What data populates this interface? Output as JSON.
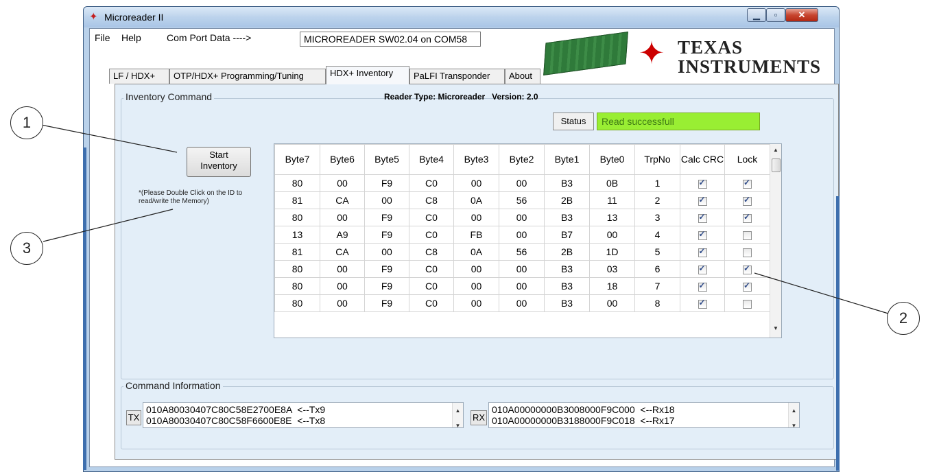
{
  "window": {
    "title": "Microreader II",
    "title_logo_icon": "ti-icon",
    "controls": {
      "minimize": "minimize-icon",
      "maximize": "maximize-icon",
      "close": "close-icon"
    }
  },
  "menu": {
    "file": "File",
    "help": "Help",
    "com_port_label": "Com Port Data ---->",
    "com_port_value": "MICROREADER SW02.04 on COM58"
  },
  "brand": {
    "line1": "Texas",
    "line2": "Instruments"
  },
  "tabs": [
    {
      "label": "LF / HDX+"
    },
    {
      "label": "OTP/HDX+ Programming/Tuning"
    },
    {
      "label": "HDX+ Inventory"
    },
    {
      "label": "PaLFI Transponder"
    },
    {
      "label": "About"
    }
  ],
  "inventory": {
    "group_title": "Inventory Command",
    "reader_type": "Reader Type: Microreader   Version: 2.0",
    "status_label": "Status",
    "status_value": "Read successfull",
    "start_button_line1": "Start",
    "start_button_line2": "Inventory",
    "note": "*(Please Double Click on the ID to read/write the Memory)"
  },
  "grid": {
    "headers": [
      "Byte7",
      "Byte6",
      "Byte5",
      "Byte4",
      "Byte3",
      "Byte2",
      "Byte1",
      "Byte0",
      "TrpNo",
      "Calc CRC",
      "Lock"
    ],
    "rows": [
      {
        "cells": [
          "80",
          "00",
          "F9",
          "C0",
          "00",
          "00",
          "B3",
          "0B",
          "1"
        ],
        "calc_crc": true,
        "lock": true
      },
      {
        "cells": [
          "81",
          "CA",
          "00",
          "C8",
          "0A",
          "56",
          "2B",
          "11",
          "2"
        ],
        "calc_crc": true,
        "lock": true
      },
      {
        "cells": [
          "80",
          "00",
          "F9",
          "C0",
          "00",
          "00",
          "B3",
          "13",
          "3"
        ],
        "calc_crc": true,
        "lock": true
      },
      {
        "cells": [
          "13",
          "A9",
          "F9",
          "C0",
          "FB",
          "00",
          "B7",
          "00",
          "4"
        ],
        "calc_crc": true,
        "lock": false
      },
      {
        "cells": [
          "81",
          "CA",
          "00",
          "C8",
          "0A",
          "56",
          "2B",
          "1D",
          "5"
        ],
        "calc_crc": true,
        "lock": false
      },
      {
        "cells": [
          "80",
          "00",
          "F9",
          "C0",
          "00",
          "00",
          "B3",
          "03",
          "6"
        ],
        "calc_crc": true,
        "lock": true
      },
      {
        "cells": [
          "80",
          "00",
          "F9",
          "C0",
          "00",
          "00",
          "B3",
          "18",
          "7"
        ],
        "calc_crc": true,
        "lock": true
      },
      {
        "cells": [
          "80",
          "00",
          "F9",
          "C0",
          "00",
          "00",
          "B3",
          "00",
          "8"
        ],
        "calc_crc": true,
        "lock": false
      }
    ],
    "scroll_up_icon": "scroll-up-icon",
    "scroll_down_icon": "scroll-down-icon"
  },
  "command_info": {
    "group_title": "Command Information",
    "tx_label": "TX",
    "tx_lines": [
      "010A80030407C80C58E2700E8A  <--Tx9",
      "010A80030407C80C58F6600E8E  <--Tx8"
    ],
    "rx_label": "RX",
    "rx_lines": [
      "010A00000000B3008000F9C000  <--Rx18",
      "010A00000000B3188000F9C018  <--Rx17"
    ]
  },
  "callouts": [
    "1",
    "2",
    "3"
  ]
}
